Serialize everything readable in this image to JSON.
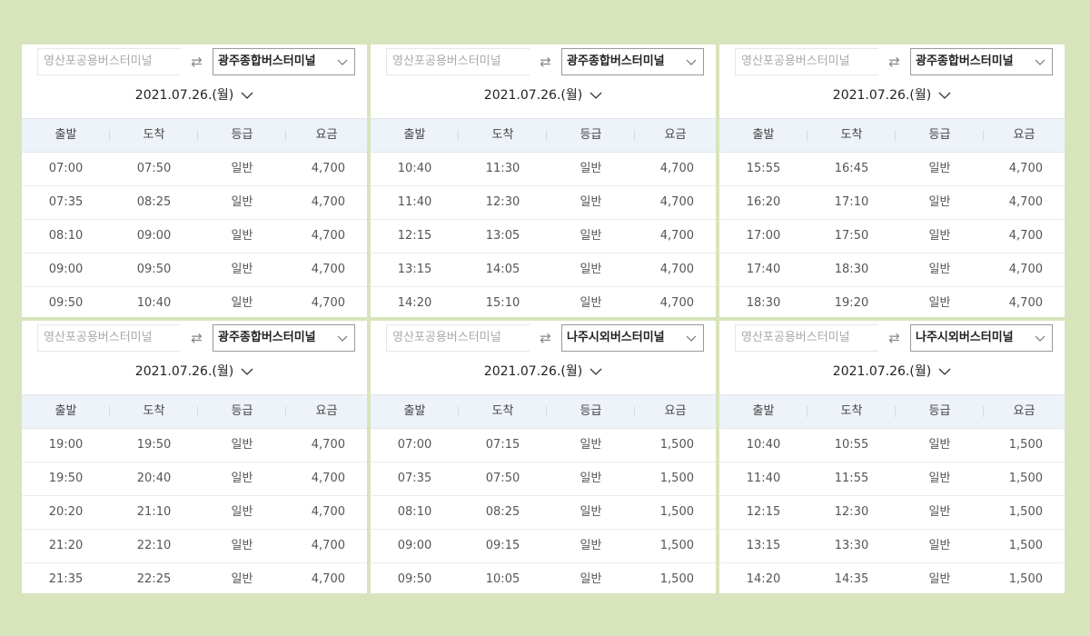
{
  "panels": [
    {
      "origin": "영산포공용버스터미널",
      "destination": "광주종합버스터미널",
      "date": "2021.07.26.(월)",
      "headers": [
        "출발",
        "도착",
        "등급",
        "요금"
      ],
      "rows": [
        [
          "07:00",
          "07:50",
          "일반",
          "4,700"
        ],
        [
          "07:35",
          "08:25",
          "일반",
          "4,700"
        ],
        [
          "08:10",
          "09:00",
          "일반",
          "4,700"
        ],
        [
          "09:00",
          "09:50",
          "일반",
          "4,700"
        ],
        [
          "09:50",
          "10:40",
          "일반",
          "4,700"
        ]
      ]
    },
    {
      "origin": "영산포공용버스터미널",
      "destination": "광주종합버스터미널",
      "date": "2021.07.26.(월)",
      "headers": [
        "출발",
        "도착",
        "등급",
        "요금"
      ],
      "rows": [
        [
          "10:40",
          "11:30",
          "일반",
          "4,700"
        ],
        [
          "11:40",
          "12:30",
          "일반",
          "4,700"
        ],
        [
          "12:15",
          "13:05",
          "일반",
          "4,700"
        ],
        [
          "13:15",
          "14:05",
          "일반",
          "4,700"
        ],
        [
          "14:20",
          "15:10",
          "일반",
          "4,700"
        ]
      ]
    },
    {
      "origin": "영산포공용버스터미널",
      "destination": "광주종합버스터미널",
      "date": "2021.07.26.(월)",
      "headers": [
        "출발",
        "도착",
        "등급",
        "요금"
      ],
      "rows": [
        [
          "15:55",
          "16:45",
          "일반",
          "4,700"
        ],
        [
          "16:20",
          "17:10",
          "일반",
          "4,700"
        ],
        [
          "17:00",
          "17:50",
          "일반",
          "4,700"
        ],
        [
          "17:40",
          "18:30",
          "일반",
          "4,700"
        ],
        [
          "18:30",
          "19:20",
          "일반",
          "4,700"
        ]
      ]
    },
    {
      "origin": "영산포공용버스터미널",
      "destination": "광주종합버스터미널",
      "date": "2021.07.26.(월)",
      "headers": [
        "출발",
        "도착",
        "등급",
        "요금"
      ],
      "rows": [
        [
          "19:00",
          "19:50",
          "일반",
          "4,700"
        ],
        [
          "19:50",
          "20:40",
          "일반",
          "4,700"
        ],
        [
          "20:20",
          "21:10",
          "일반",
          "4,700"
        ],
        [
          "21:20",
          "22:10",
          "일반",
          "4,700"
        ],
        [
          "21:35",
          "22:25",
          "일반",
          "4,700"
        ]
      ]
    },
    {
      "origin": "영산포공용버스터미널",
      "destination": "나주시외버스터미널",
      "date": "2021.07.26.(월)",
      "headers": [
        "출발",
        "도착",
        "등급",
        "요금"
      ],
      "rows": [
        [
          "07:00",
          "07:15",
          "일반",
          "1,500"
        ],
        [
          "07:35",
          "07:50",
          "일반",
          "1,500"
        ],
        [
          "08:10",
          "08:25",
          "일반",
          "1,500"
        ],
        [
          "09:00",
          "09:15",
          "일반",
          "1,500"
        ],
        [
          "09:50",
          "10:05",
          "일반",
          "1,500"
        ]
      ]
    },
    {
      "origin": "영산포공용버스터미널",
      "destination": "나주시외버스터미널",
      "date": "2021.07.26.(월)",
      "headers": [
        "출발",
        "도착",
        "등급",
        "요금"
      ],
      "rows": [
        [
          "10:40",
          "10:55",
          "일반",
          "1,500"
        ],
        [
          "11:40",
          "11:55",
          "일반",
          "1,500"
        ],
        [
          "12:15",
          "12:30",
          "일반",
          "1,500"
        ],
        [
          "13:15",
          "13:30",
          "일반",
          "1,500"
        ],
        [
          "14:20",
          "14:35",
          "일반",
          "1,500"
        ]
      ]
    }
  ]
}
